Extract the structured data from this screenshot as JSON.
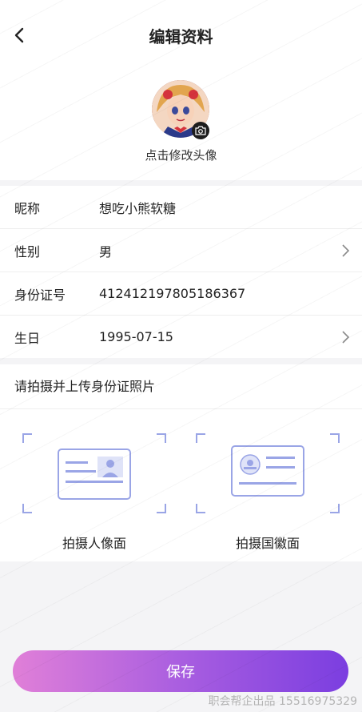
{
  "header": {
    "title": "编辑资料"
  },
  "avatar": {
    "change_label": "点击修改头像"
  },
  "profile": {
    "rows": [
      {
        "label": "昵称",
        "value": "想吃小熊软糖",
        "chevron": false
      },
      {
        "label": "性别",
        "value": "男",
        "chevron": true
      },
      {
        "label": "身份证号",
        "value": "412412197805186367",
        "chevron": false
      },
      {
        "label": "生日",
        "value": "1995-07-15",
        "chevron": true
      }
    ]
  },
  "id_upload": {
    "prompt": "请拍摄并上传身份证照片",
    "front_label": "拍摄人像面",
    "back_label": "拍摄国徽面"
  },
  "actions": {
    "save_label": "保存"
  },
  "watermark": {
    "text": "职会帮企出品 15516975329"
  },
  "colors": {
    "accent_start": "#e07fd8",
    "accent_end": "#7b3ee0",
    "card_line": "#9aa5e6"
  }
}
